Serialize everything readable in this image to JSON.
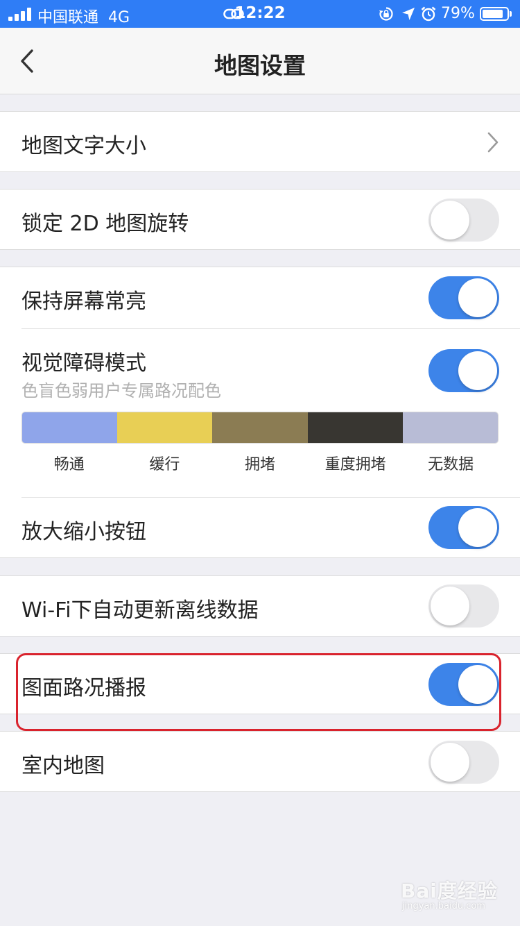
{
  "status_bar": {
    "carrier": "中国联通",
    "network": "4G",
    "time": "12:22",
    "battery_percent": "79%",
    "battery_level": 0.79,
    "icons": [
      "signal-icon",
      "link-icon",
      "orientation-lock-icon",
      "location-arrow-icon",
      "alarm-icon",
      "battery-icon"
    ]
  },
  "nav": {
    "title": "地图设置",
    "back_icon": "chevron-left-icon"
  },
  "settings": {
    "text_size": {
      "label": "地图文字大小",
      "icon": "chevron-right-icon"
    },
    "lock_2d": {
      "label": "锁定 2D 地图旋转",
      "checked": false
    },
    "keep_screen_on": {
      "label": "保持屏幕常亮",
      "checked": true
    },
    "visual_impairment": {
      "label": "视觉障碍模式",
      "description": "色盲色弱用户专属路况配色",
      "checked": true,
      "legend": [
        {
          "label": "畅通",
          "color": "#8fa5ea"
        },
        {
          "label": "缓行",
          "color": "#e8cf55"
        },
        {
          "label": "拥堵",
          "color": "#8b7c53"
        },
        {
          "label": "重度拥堵",
          "color": "#383631"
        },
        {
          "label": "无数据",
          "color": "#b8bcd6"
        }
      ]
    },
    "zoom_buttons": {
      "label": "放大缩小按钮",
      "checked": true
    },
    "wifi_update": {
      "label": "Wi-Fi下自动更新离线数据",
      "checked": false
    },
    "traffic_broadcast": {
      "label": "图面路况播报",
      "checked": true
    },
    "indoor_map": {
      "label": "室内地图",
      "checked": false
    }
  },
  "colors": {
    "status_bar": "#2f7df6",
    "toggle_on": "#3d84e9",
    "toggle_off": "#e8e8ea",
    "highlight": "#d9232d"
  },
  "watermark": {
    "main": "Bai度经验",
    "sub": "jingyan.baidu.com"
  }
}
